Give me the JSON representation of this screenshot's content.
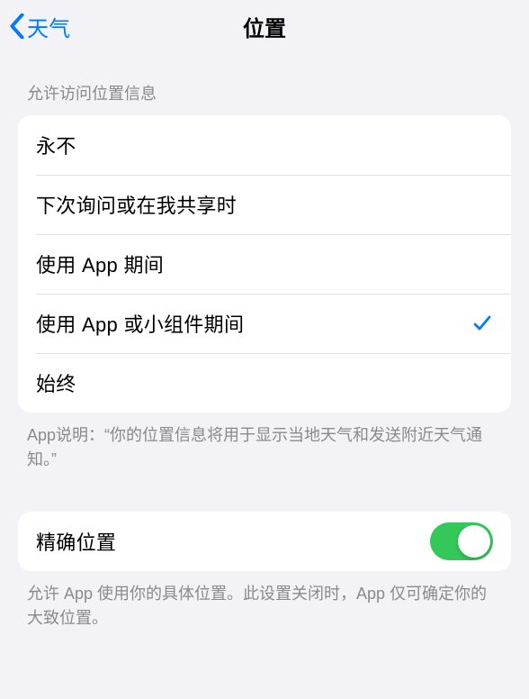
{
  "nav": {
    "back_label": "天气",
    "title": "位置"
  },
  "access": {
    "header": "允许访问位置信息",
    "options": [
      {
        "label": "永不",
        "selected": false
      },
      {
        "label": "下次询问或在我共享时",
        "selected": false
      },
      {
        "label": "使用 App 期间",
        "selected": false
      },
      {
        "label": "使用 App 或小组件期间",
        "selected": true
      },
      {
        "label": "始终",
        "selected": false
      }
    ],
    "footer": "App说明：“你的位置信息将用于显示当地天气和发送附近天气通知。”"
  },
  "precise": {
    "label": "精确位置",
    "enabled": true,
    "footer": "允许 App 使用你的具体位置。此设置关闭时，App 仅可确定你的大致位置。"
  }
}
